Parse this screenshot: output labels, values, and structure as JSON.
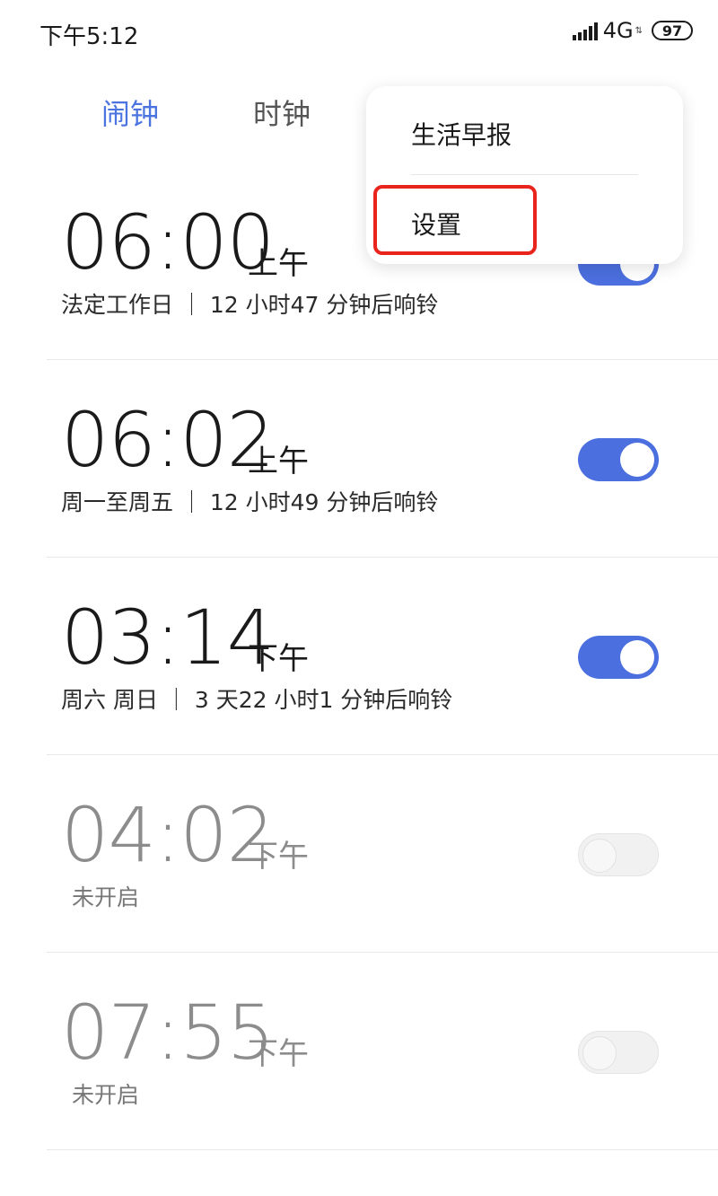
{
  "status_bar": {
    "time": "下午5:12",
    "network": "4G",
    "battery": "97",
    "icons": [
      "signal-icon",
      "data-arrows-icon",
      "battery-icon"
    ]
  },
  "tabs": [
    {
      "label": "闹钟",
      "active": true
    },
    {
      "label": "时钟",
      "active": false
    }
  ],
  "colors": {
    "accent": "#4c74e0",
    "toggle_on": "#4c6fdf",
    "toggle_off": "#f1f1f1",
    "highlight": "#e8241c"
  },
  "menu": {
    "items": [
      "生活早报",
      "设置"
    ]
  },
  "alarms": [
    {
      "time": "06:00",
      "ampm": "上午",
      "desc": "法定工作日 ｜ 12 小时47 分钟后响铃",
      "enabled": true
    },
    {
      "time": "06:02",
      "ampm": "上午",
      "desc": "周一至周五 ｜ 12 小时49 分钟后响铃",
      "enabled": true
    },
    {
      "time": "03:14",
      "ampm": "下午",
      "desc": "周六 周日 ｜ 3 天22 小时1 分钟后响铃",
      "enabled": true
    },
    {
      "time": "04:02",
      "ampm": "下午",
      "desc": "未开启",
      "enabled": false
    },
    {
      "time": "07:55",
      "ampm": "下午",
      "desc": "未开启",
      "enabled": false
    }
  ]
}
